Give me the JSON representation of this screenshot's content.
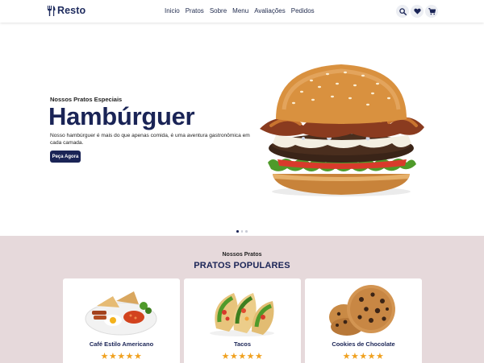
{
  "header": {
    "logo_text": "Resto",
    "nav": [
      "Inicio",
      "Pratos",
      "Sobre",
      "Menu",
      "Avaliações",
      "Pedidos"
    ],
    "icons": [
      "search-icon",
      "heart-icon",
      "cart-icon"
    ]
  },
  "hero": {
    "eyebrow": "Nossos Pratos Especiais",
    "title": "Hambúrguer",
    "description": "Nosso hambúrguer é mais do que apenas comida, é uma aventura gastronômica em cada camada.",
    "cta_label": "Peça Agora",
    "slides_total": 3,
    "active_slide": 1
  },
  "popular": {
    "eyebrow": "Nossos Pratos",
    "title": "PRATOS POPULARES",
    "items": [
      {
        "name": "Café Estilo Americano",
        "stars": "★★★★★"
      },
      {
        "name": "Tacos",
        "stars": "★★★★★"
      },
      {
        "name": "Cookies de Chocolate",
        "stars": "★★★★★"
      }
    ]
  },
  "colors": {
    "brand": "#1a2456",
    "section_bg": "#e6d9db",
    "star": "#f0a120"
  }
}
